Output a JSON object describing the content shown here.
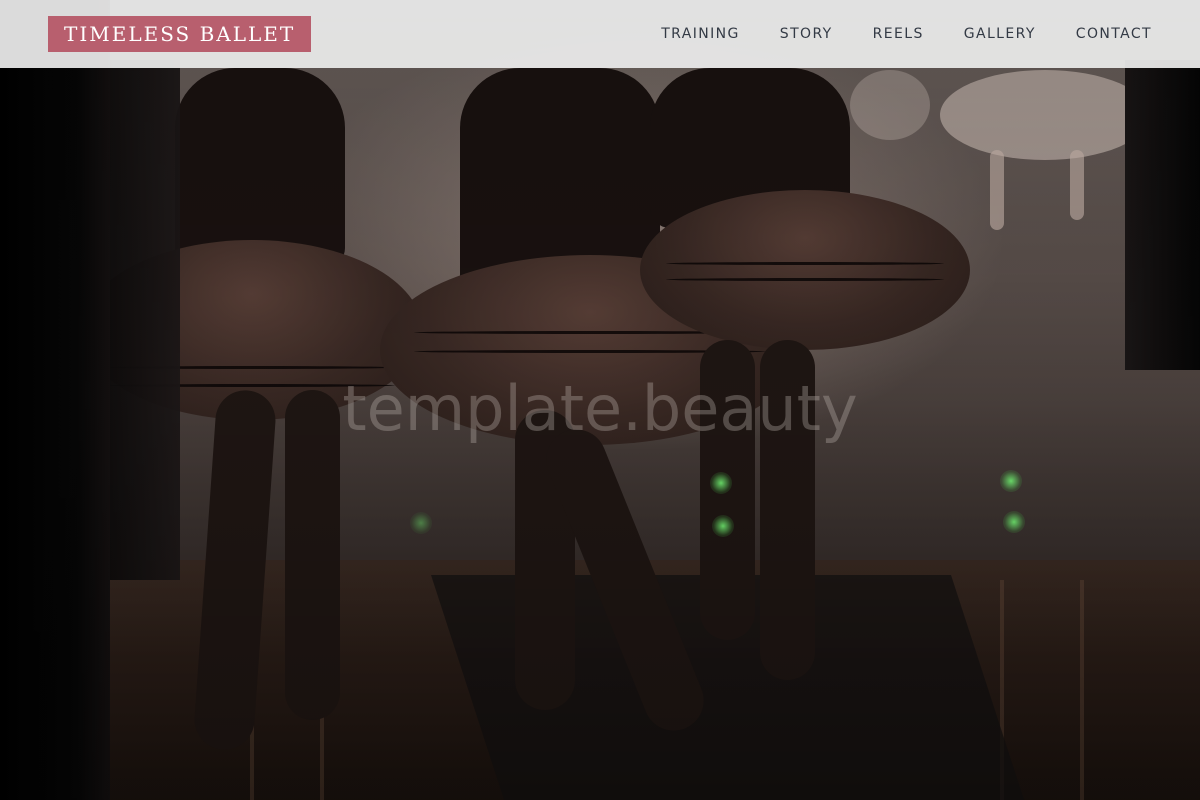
{
  "nav": {
    "brand": "TIMELESS BALLET",
    "brand_color": "#b85f6e",
    "links": [
      {
        "label": "TRAINING"
      },
      {
        "label": "STORY"
      },
      {
        "label": "REELS"
      },
      {
        "label": "GALLERY"
      },
      {
        "label": "CONTACT"
      }
    ]
  },
  "hero": {
    "watermark": "template.beauty"
  }
}
